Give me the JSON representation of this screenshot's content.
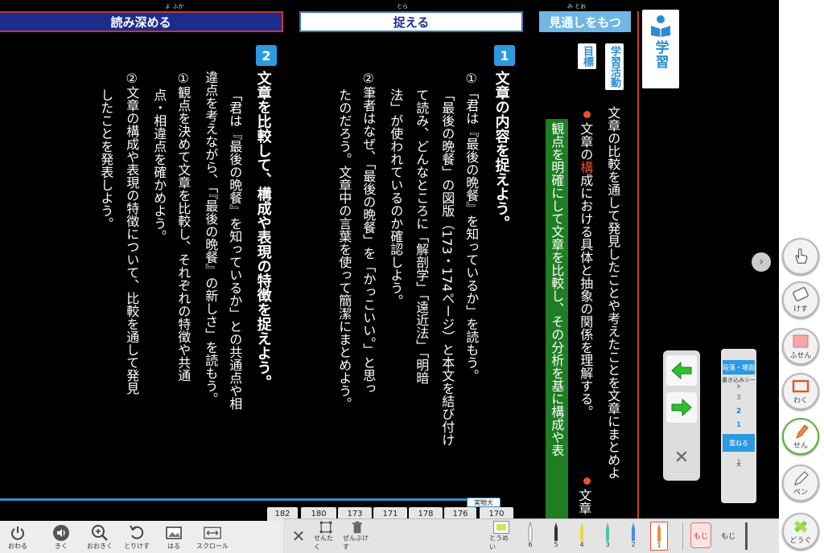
{
  "headers": {
    "deepen": "読み深める",
    "deepen_ruby": "よ ふか",
    "capture": "捉える",
    "capture_ruby": "とら",
    "outlook": "見通しをもつ",
    "outlook_ruby": "み とお"
  },
  "gakushu_badge": "学習",
  "tag_activity": "学習活動",
  "tag_goal": "目標",
  "goal_text": {
    "line1": "文章の比較を通して発見したことや考えたことを文章にまとめよ",
    "line2_pre": "文章の",
    "line2_kw": "構",
    "line2_post": "成における具体と抽象の関係を理解する。",
    "line3": "観点を明確にして文章を比較し、その分析を基に構成や表",
    "line4_pre": "文章"
  },
  "task1": {
    "number": "1",
    "heading": "文章の内容を捉えよう。",
    "items": [
      "①「君は『最後の晩餐』を知っているか」を読もう。",
      "「最後の晩餐」の図版（173・174ページ）と本文を結び付け",
      "て読み、どんなところに「解剖学」「遠近法」「明暗",
      "法」が使われているのか確認しよう。",
      "②筆者はなぜ、「最後の晩餐」を「かっこいい。」と思っ",
      "たのだろう。文章中の言葉を使って簡潔にまとめよう。"
    ]
  },
  "task2": {
    "number": "2",
    "heading": "文章を比較して、構成や表現の特徴を捉えよう。",
    "items": [
      "「君は『最後の晩餐』を知っているか」との共通点や相",
      "違点を考えながら、「『最後の晩餐』の新しさ」を読もう。",
      "①観点を決めて文章を比較し、それぞれの特徴や共通",
      "点・相違点を確かめよう。",
      "②文章の構成や表現の特徴について、比較を通して発見",
      "したことを発表しよう。"
    ]
  },
  "page_tabs": [
    "182",
    "180",
    "173",
    "171",
    "178",
    "176",
    "170"
  ],
  "current_page_label": "実物大",
  "bottom_bar": {
    "end": "おわる",
    "listen": "きく",
    "zoom": "おおきく",
    "undo": "とりけす",
    "paste": "はる",
    "scroll": "スクロール"
  },
  "tool_bar": {
    "select": "せんたく",
    "erase_all": "ぜんぶけす",
    "transparent": "とうめい",
    "pens": [
      "6",
      "5",
      "4",
      "3",
      "2",
      "1"
    ],
    "moji": "もじ"
  },
  "side_buttons": {
    "hand": "",
    "erase": "けす",
    "sticky": "ふせん",
    "frame": "わく",
    "line": "せん",
    "pen": "ペン",
    "tools": "どうぐ"
  },
  "layer_panel": {
    "mode": "段落・場面",
    "sheet": "書き込みシート",
    "layers": [
      "3",
      "2",
      "1"
    ],
    "stack": "重ねる"
  },
  "colors": {
    "header_blue": "#1c2c8c",
    "accent_red": "#c84326",
    "badge_blue": "#2c9ae0",
    "highlight_green": "#1f7d23"
  }
}
